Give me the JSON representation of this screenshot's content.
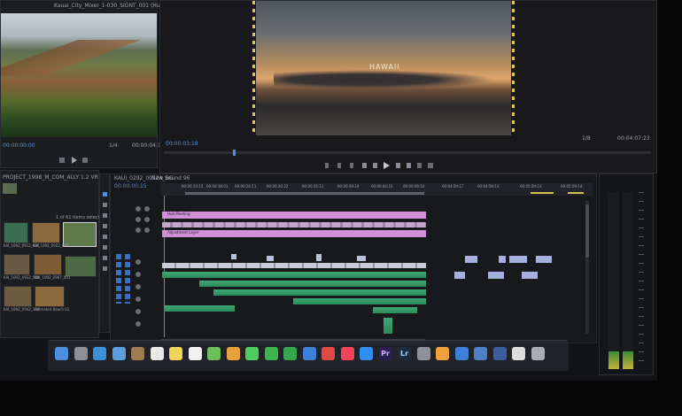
{
  "source_monitor": {
    "title": "Kauai_City_Mixer_1-030_SIGNT_001 (Hub)",
    "timecode": "00:00:00:00",
    "duration": "00:00:04:14",
    "fit": "1/4"
  },
  "program_monitor": {
    "title_overlay": "HAWAII",
    "timecode": "00:00:03:18",
    "duration": "00:04:07:23",
    "fit": "1/8"
  },
  "project_panel": {
    "header": "PROJECT_1998_M_COM_ALLY 1.2 VR",
    "bins": [
      {
        "name": "KAI_1092_0912_005",
        "color": "#3d6e54"
      },
      {
        "name": "KAI_1092_0922_006",
        "color": "#8a6a3c"
      },
      {
        "name": "KAI_1092_0921_022",
        "color": "#5f7a4a"
      },
      {
        "name": "KAI_1092_0932_008",
        "color": "#6b5a43"
      },
      {
        "name": "KAI_1092_0987_001",
        "color": "#7d5c35"
      },
      {
        "name": "KAI_1092_0994_000",
        "color": "#4e6a45"
      },
      {
        "name": "KAI_1092_0942_100",
        "color": "#6e5a3e"
      },
      {
        "name": "Animated Beach 01",
        "color": "#8e6b3f"
      }
    ],
    "item_count": "1 of 61 items selected"
  },
  "timeline": {
    "tab": "KAUI_0292_0012A_BG",
    "tab2": "New Sound 96",
    "timecode": "00:00:00:15",
    "ruler": [
      "00:00:10:15",
      "00:00:18:01",
      "00:00:26:11",
      "00:00:30:22",
      "00:00:35:11",
      "00:00:39:19",
      "00:00:44:10",
      "00:00:49:10",
      "00:04:29:17",
      "00:04:58:14",
      "00:05:29:14",
      "00:05:59:14"
    ],
    "tracks": [
      "V3",
      "V2",
      "V1",
      "A1",
      "A2",
      "A3",
      "A4",
      "A5"
    ],
    "graphic_label": "Hub Meeting",
    "adjustment_label": "Adjustment Layer"
  },
  "dock": {
    "icons": [
      {
        "name": "finder-icon",
        "color": "#4a8fe0",
        "label": ""
      },
      {
        "name": "launchpad-icon",
        "color": "#8c8f96",
        "label": ""
      },
      {
        "name": "safari-icon",
        "color": "#3c8fd9",
        "label": ""
      },
      {
        "name": "mail-icon",
        "color": "#5aa0e0",
        "label": ""
      },
      {
        "name": "contacts-icon",
        "color": "#a07a50",
        "label": ""
      },
      {
        "name": "calendar-icon",
        "color": "#e8e8e8",
        "label": ""
      },
      {
        "name": "notes-icon",
        "color": "#f0d45a",
        "label": ""
      },
      {
        "name": "reminders-icon",
        "color": "#f2f2f2",
        "label": ""
      },
      {
        "name": "maps-icon",
        "color": "#6cbf5a",
        "label": ""
      },
      {
        "name": "photos-icon",
        "color": "#e9a23b",
        "label": ""
      },
      {
        "name": "messages-icon",
        "color": "#4fca5c",
        "label": ""
      },
      {
        "name": "facetime-icon",
        "color": "#3fb44c",
        "label": ""
      },
      {
        "name": "numbers-icon",
        "color": "#36a64f",
        "label": ""
      },
      {
        "name": "keynote-icon",
        "color": "#3d7fd6",
        "label": ""
      },
      {
        "name": "news-icon",
        "color": "#e34848",
        "label": ""
      },
      {
        "name": "music-icon",
        "color": "#f2435a",
        "label": ""
      },
      {
        "name": "app-store-icon",
        "color": "#2f8ef0",
        "label": ""
      },
      {
        "name": "premiere-icon",
        "color": "#2a1f4f",
        "label": "Pr"
      },
      {
        "name": "lightroom-icon",
        "color": "#1e2c3d",
        "label": "Lr"
      },
      {
        "name": "system-preferences-icon",
        "color": "#8e9199",
        "label": ""
      },
      {
        "name": "stocks-icon",
        "color": "#f0a13a",
        "label": ""
      },
      {
        "name": "xcode-icon",
        "color": "#3f7fd9",
        "label": ""
      },
      {
        "name": "quicktime-icon",
        "color": "#4e80c8",
        "label": ""
      },
      {
        "name": "lightroom-classic-icon",
        "color": "#3c5e9e",
        "label": ""
      },
      {
        "name": "downloads-icon",
        "color": "#dcdcdc",
        "label": ""
      },
      {
        "name": "trash-icon",
        "color": "#a9acb3",
        "label": ""
      }
    ]
  }
}
